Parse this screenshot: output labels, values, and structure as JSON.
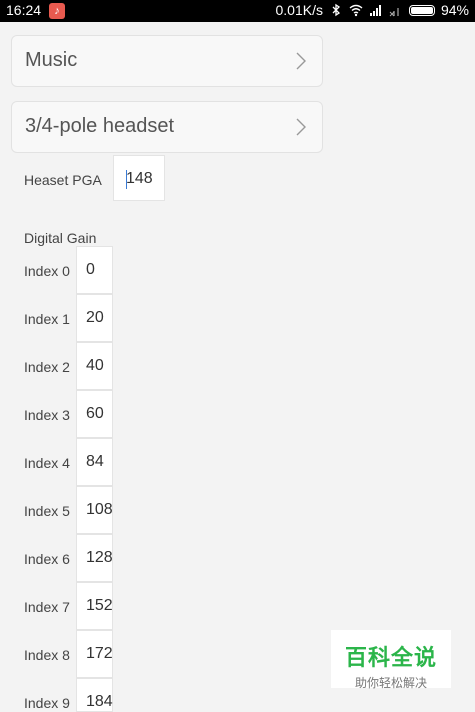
{
  "status_bar": {
    "time": "16:24",
    "speed": "0.01K/s",
    "battery": "94%"
  },
  "music_select": {
    "label": "Music"
  },
  "headset_select": {
    "label": "3/4-pole headset"
  },
  "headset_pga": {
    "label": "Heaset PGA",
    "value": "148"
  },
  "digital_gain": {
    "title": "Digital Gain",
    "rows": [
      {
        "label": "Index 0",
        "value": "0"
      },
      {
        "label": "Index 1",
        "value": "20"
      },
      {
        "label": "Index 2",
        "value": "40"
      },
      {
        "label": "Index 3",
        "value": "60"
      },
      {
        "label": "Index 4",
        "value": "84"
      },
      {
        "label": "Index 5",
        "value": "108"
      },
      {
        "label": "Index 6",
        "value": "128"
      },
      {
        "label": "Index 7",
        "value": "152"
      },
      {
        "label": "Index 8",
        "value": "172"
      },
      {
        "label": "Index 9",
        "value": "184"
      }
    ]
  },
  "watermark": {
    "title": "百科全说",
    "subtitle": "助你轻松解决"
  }
}
